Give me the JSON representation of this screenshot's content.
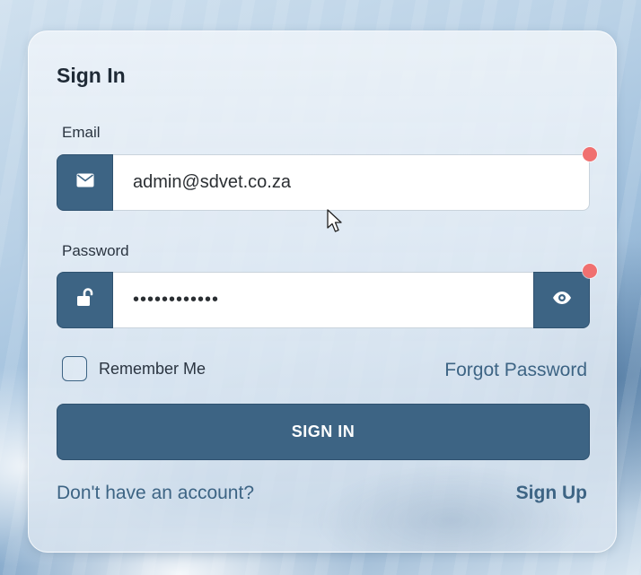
{
  "form": {
    "title": "Sign In",
    "email": {
      "label": "Email",
      "value": "admin@sdvet.co.za",
      "icon": "envelope-icon"
    },
    "password": {
      "label": "Password",
      "value": "••••••••••••",
      "icon": "unlock-icon",
      "toggle_icon": "eye-icon"
    },
    "remember_label": "Remember Me",
    "forgot_label": "Forgot Password",
    "submit_label": "SIGN IN",
    "no_account_text": "Don't have an account?",
    "signup_label": "Sign Up"
  },
  "colors": {
    "accent": "#3d6484",
    "required_dot": "#f07070",
    "card_bg": "#e4ecf4"
  }
}
